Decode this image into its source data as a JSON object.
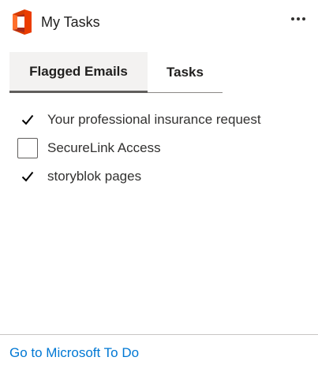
{
  "header": {
    "title": "My Tasks",
    "logo_icon": "office-logo-icon",
    "more_icon": "more-options-icon"
  },
  "tabs": [
    {
      "label": "Flagged Emails",
      "active": true
    },
    {
      "label": "Tasks",
      "active": false
    }
  ],
  "tasks": [
    {
      "label": "Your professional insurance request",
      "checked": true
    },
    {
      "label": "SecureLink Access",
      "checked": false
    },
    {
      "label": "storyblok pages",
      "checked": true
    }
  ],
  "footer": {
    "link_label": "Go to Microsoft To Do"
  },
  "colors": {
    "link": "#0078d4",
    "logo_orange": "#eb3c00",
    "logo_red": "#d83b01",
    "logo_dark": "#a92b1a"
  }
}
